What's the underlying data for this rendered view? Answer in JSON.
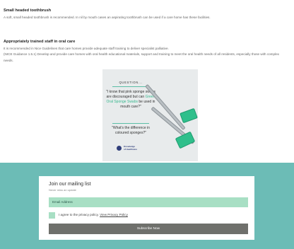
{
  "article": {
    "heading1": "Small headed toothbrush",
    "para1": "A soft, small headed toothbrush is recommended.  In nil by mouth cases an aspirating toothbrush can be used if a care home has these facilities.",
    "heading2": "Appropriately trained staff in oral care",
    "para2a": "It is recommended in Nice Guidelines that care homes provide adequate staff training to deliver specialist palliative.",
    "para2b": "(NICE Guidance 1.5.1) Develop and provide care homes with oral health educational materials, support and training to meet the oral health needs of all residents, especially those with complex needs."
  },
  "image": {
    "title": "QUESTION...",
    "quote_pre": "\"I know that pink sponge swabs are discouraged but can ",
    "quote_highlight": "Green Oral Sponge Swabs",
    "quote_post": " be used in mouth care?\"",
    "question2": "\"What's the difference in coloured sponges?\"",
    "logo_line1": "Knowledge",
    "logo_line2": "of Healthcare",
    "colors": {
      "background": "#e8ebec",
      "accent": "#2fbf8b"
    }
  },
  "mailing": {
    "title": "Join our mailing list",
    "subtitle": "Never miss an update",
    "email_placeholder": "Email Address",
    "agree_text": "I agree to the privacy policy. ",
    "privacy_link": "View Privacy Policy",
    "subscribe_label": "Subscribe Now",
    "colors": {
      "band": "#6cbcb6",
      "field": "#a8dfc4",
      "button": "#6f706c"
    }
  }
}
